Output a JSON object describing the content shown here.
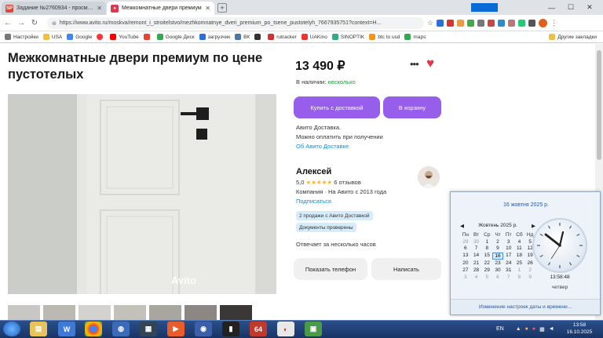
{
  "browser": {
    "tabs": [
      {
        "label": "Задание №2760934 - просмотр з",
        "favicon": "SP",
        "active": false
      },
      {
        "label": "Межкомнатные двери премиум",
        "favicon": "avito-icon",
        "active": true
      }
    ],
    "url": "https://www.avito.ru/moskva/remont_i_stroitelstvo/mezhkomnatnye_dveri_premium_po_tsene_pustotelyh_7667935751?context=H...",
    "bookmarks": [
      "Настройки",
      "USA",
      "Google",
      "YouTube",
      "Google Диск",
      "загрузчик",
      "ВК",
      "rutracker",
      "UAKino",
      "SINOPTIK",
      "btc to usd",
      "maps"
    ],
    "other_bookmarks": "Другие закладки"
  },
  "listing": {
    "title": "Межкомнатные двери премиум по цене пустотелых",
    "watermark": "Avito",
    "price": "13 490 ₽",
    "availability_label": "В наличии:",
    "availability_value": "несколько",
    "buy_button": "Купить с доставкой",
    "cart_button": "В корзину",
    "delivery_lines": [
      "Авито Доставка.",
      "Можно оплатить при получении"
    ],
    "delivery_link": "Об Авито Доставке",
    "seller_name": "Алексей",
    "rating": "5,0",
    "stars": "★★★★★",
    "reviews": "6 отзывов",
    "seller_info": "Компания · На Авито с 2013 года",
    "subscribe": "Подписаться",
    "badges": [
      "2 продажи с Авито Доставкой",
      "Документы проверены"
    ],
    "response_time": "Отвечает за несколько часов",
    "show_phone": "Показать телефон",
    "write": "Написать"
  },
  "calendar": {
    "date_header": "16 жовтня 2025 р.",
    "month_label": "Жовтень 2025 р.",
    "weekdays": [
      "Пн",
      "Вт",
      "Ср",
      "Чт",
      "Пт",
      "Сб",
      "Нд"
    ],
    "days": [
      [
        "29",
        "30",
        "1",
        "2",
        "3",
        "4",
        "5"
      ],
      [
        "6",
        "7",
        "8",
        "9",
        "10",
        "11",
        "12"
      ],
      [
        "13",
        "14",
        "15",
        "16",
        "17",
        "18",
        "19"
      ],
      [
        "20",
        "21",
        "22",
        "23",
        "24",
        "25",
        "26"
      ],
      [
        "27",
        "28",
        "29",
        "30",
        "31",
        "1",
        "2"
      ],
      [
        "3",
        "4",
        "5",
        "6",
        "7",
        "8",
        "9"
      ]
    ],
    "selected_day": "16",
    "clock_time": "13:58:48",
    "clock_day": "четвер",
    "settings_link": "Изменение настроек даты и времени..."
  },
  "taskbar": {
    "language": "EN",
    "time": "13:58",
    "date": "16.10.2025",
    "app_label_64": "64"
  },
  "colors": {
    "accent": "#965eeb",
    "heart": "#e0374d",
    "link": "#0a8de6",
    "available": "#1e9e3e"
  }
}
